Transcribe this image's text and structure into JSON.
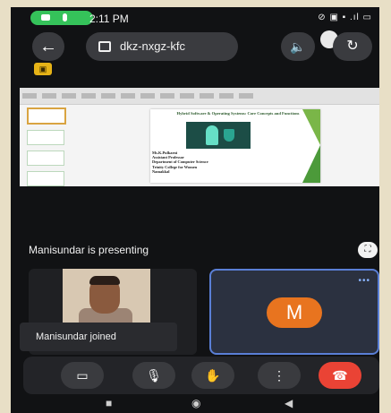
{
  "status_bar": {
    "time": "2:11 PM",
    "right_icons": "⊘ ▣ ▪ .ıl ▭"
  },
  "top_bar": {
    "meeting_code": "dkz-nxgz-kfc",
    "back": "←",
    "speaker": "🔈",
    "flip": "↻"
  },
  "badge": "▣",
  "slide": {
    "title": "Hybrid Software & Operating Systems: Core Concepts and Functions",
    "lines": [
      "Ms.K.Pulkarni",
      "Assistant Professor",
      "Department of Computer Science",
      "Trinity College for Women",
      "Namakkal"
    ]
  },
  "presenting_label": "Manisundar is presenting",
  "fullscreen_icon": "⛶",
  "toast": "Manisundar joined",
  "avatar_letter": "M",
  "more_dots": "•••",
  "controls": {
    "camera": "▭",
    "mic": "🎙",
    "hand": "✋",
    "more": "⋮",
    "end": "☎"
  },
  "navbar": {
    "square": "■",
    "home": "◉",
    "back": "◀"
  }
}
